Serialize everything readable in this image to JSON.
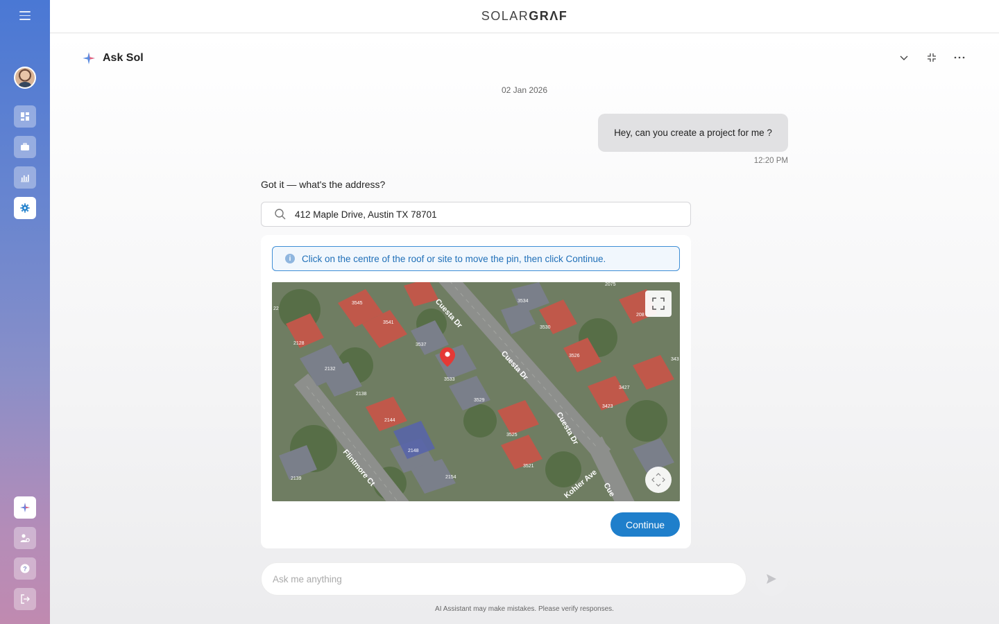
{
  "app": {
    "logo_left": "SOLAR",
    "logo_right": "GRΛF"
  },
  "sidebar": {
    "items": [
      {
        "name": "dashboard",
        "icon": "grid-icon"
      },
      {
        "name": "projects",
        "icon": "briefcase-icon"
      },
      {
        "name": "reports",
        "icon": "bar-chart-icon"
      },
      {
        "name": "settings",
        "icon": "gear-icon",
        "active": true
      }
    ],
    "bottom": [
      {
        "name": "ask-sol",
        "icon": "sparkle-icon"
      },
      {
        "name": "user-settings",
        "icon": "user-gear-icon"
      },
      {
        "name": "help",
        "icon": "help-icon"
      },
      {
        "name": "logout",
        "icon": "logout-icon"
      }
    ]
  },
  "chat": {
    "title": "Ask Sol",
    "date": "02 Jan 2026",
    "user_message": "Hey, can you create a project for me ?",
    "user_time": "12:20 PM",
    "bot_message": "Got it — what's the address?",
    "address_value": "412 Maple Drive, Austin TX 78701",
    "info_banner": "Click on the centre of the roof or site to move the pin, then click Continue.",
    "continue_label": "Continue",
    "composer_placeholder": "Ask me anything",
    "disclaimer": "AI Assistant may make mistakes. Please verify responses."
  },
  "map": {
    "streets": [
      "Cuesta Dr",
      "Cuesta Dr",
      "Cuesta Dr",
      "Flintmore Ct",
      "Kohler Ave",
      "Cue"
    ],
    "house_numbers": [
      "3545",
      "3541",
      "3537",
      "3533",
      "3529",
      "3525",
      "3521",
      "3534",
      "3530",
      "3526",
      "3427",
      "3423",
      "2128",
      "2132",
      "2138",
      "2144",
      "2148",
      "2154",
      "2139",
      "2075",
      "208",
      "343",
      "22"
    ]
  },
  "colors": {
    "accent": "#1f7fcb",
    "pin": "#e53935",
    "banner_border": "#3f8ed6"
  }
}
